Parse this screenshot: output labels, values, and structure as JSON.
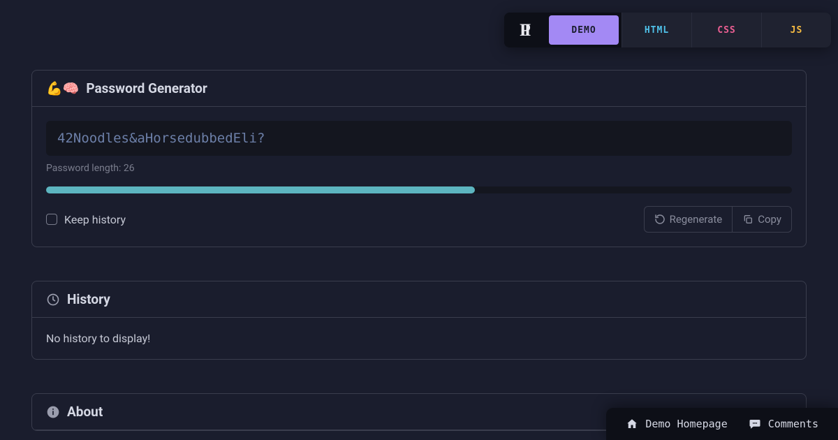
{
  "toolbar": {
    "tabs": {
      "demo": "DEMO",
      "html": "HTML",
      "css": "CSS",
      "js": "JS"
    }
  },
  "generator": {
    "title_emoji": "💪🧠",
    "title": "Password Generator",
    "password": "42Noodles&aHorsedubbedEli?",
    "length_label": "Password length: 26",
    "slider_percent": 57.5,
    "keep_history_label": "Keep history",
    "regenerate_label": "Regenerate",
    "copy_label": "Copy"
  },
  "history": {
    "title": "History",
    "empty_text": "No history to display!"
  },
  "about": {
    "title": "About"
  },
  "bottom": {
    "homepage": "Demo Homepage",
    "comments": "Comments"
  },
  "colors": {
    "accent_purple": "#a389f4",
    "accent_teal": "#5db5c0",
    "accent_blue": "#4fc1e9",
    "accent_pink": "#ec5f93",
    "accent_yellow": "#f6bb42"
  }
}
